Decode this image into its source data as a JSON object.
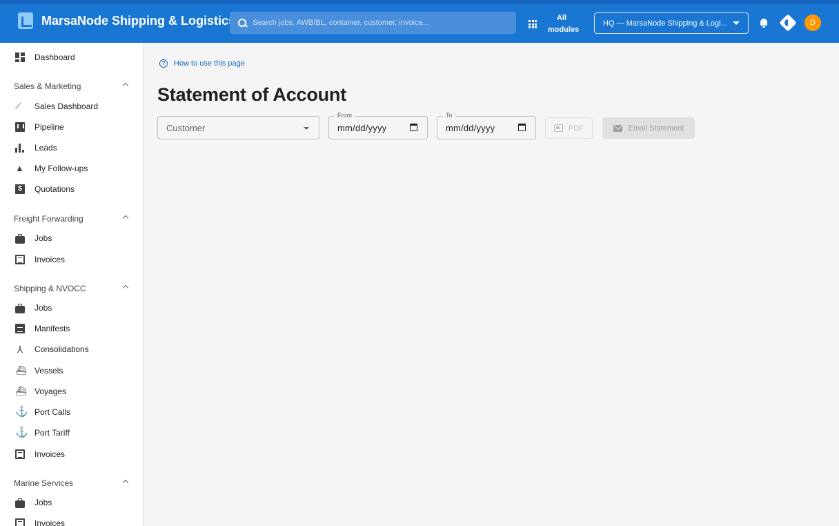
{
  "app": {
    "title": "MarsaNode Shipping & Logistics"
  },
  "search": {
    "placeholder": "Search jobs, AWB/BL, container, customer, invoice..."
  },
  "header": {
    "modules_label": "All modules",
    "org_selector": "HQ — MarsaNode Shipping & Logi...",
    "avatar_initial": "D"
  },
  "sidebar": {
    "dashboard": "Dashboard",
    "sections": [
      {
        "title": "Sales & Marketing",
        "items": [
          "Sales Dashboard",
          "Pipeline",
          "Leads",
          "My Follow-ups",
          "Quotations"
        ]
      },
      {
        "title": "Freight Forwarding",
        "items": [
          "Jobs",
          "Invoices"
        ]
      },
      {
        "title": "Shipping & NVOCC",
        "items": [
          "Jobs",
          "Manifests",
          "Consolidations",
          "Vessels",
          "Voyages",
          "Port Calls",
          "Port Tariff",
          "Invoices"
        ]
      },
      {
        "title": "Marine Services",
        "items": [
          "Jobs",
          "Invoices"
        ]
      }
    ]
  },
  "main": {
    "help_link": "How to use this page",
    "title": "Statement of Account",
    "customer_placeholder": "Customer",
    "from_label": "From",
    "from_value": "mm/dd/yyyy",
    "to_label": "To",
    "to_value": "mm/dd/yyyy",
    "pdf_button": "PDF",
    "email_button": "Email Statement"
  },
  "colors": {
    "primary": "#1976d2",
    "accent_avatar": "#ff9800",
    "link": "#1565c0"
  }
}
